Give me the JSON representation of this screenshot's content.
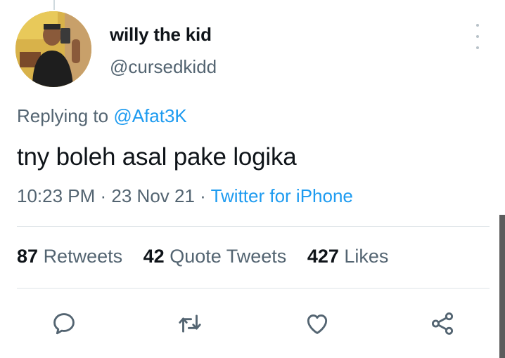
{
  "tweet": {
    "author": {
      "name": "willy the kid",
      "handle": "@cursedkidd"
    },
    "reply": {
      "prefix": "Replying to ",
      "mention": "@Afat3K"
    },
    "text": "tny boleh asal pake logika",
    "meta": {
      "time": "10:23 PM",
      "separator": " · ",
      "date": "23 Nov 21",
      "source": "Twitter for iPhone"
    },
    "stats": {
      "retweets": {
        "count": "87",
        "label": "Retweets"
      },
      "quote_tweets": {
        "count": "42",
        "label": "Quote Tweets"
      },
      "likes": {
        "count": "427",
        "label": "Likes"
      }
    },
    "actions": [
      "reply-icon",
      "retweet-icon",
      "like-icon",
      "share-icon"
    ]
  },
  "colors": {
    "accent": "#1d9bf0",
    "secondary_text": "#536471",
    "primary_text": "#0f1419"
  }
}
